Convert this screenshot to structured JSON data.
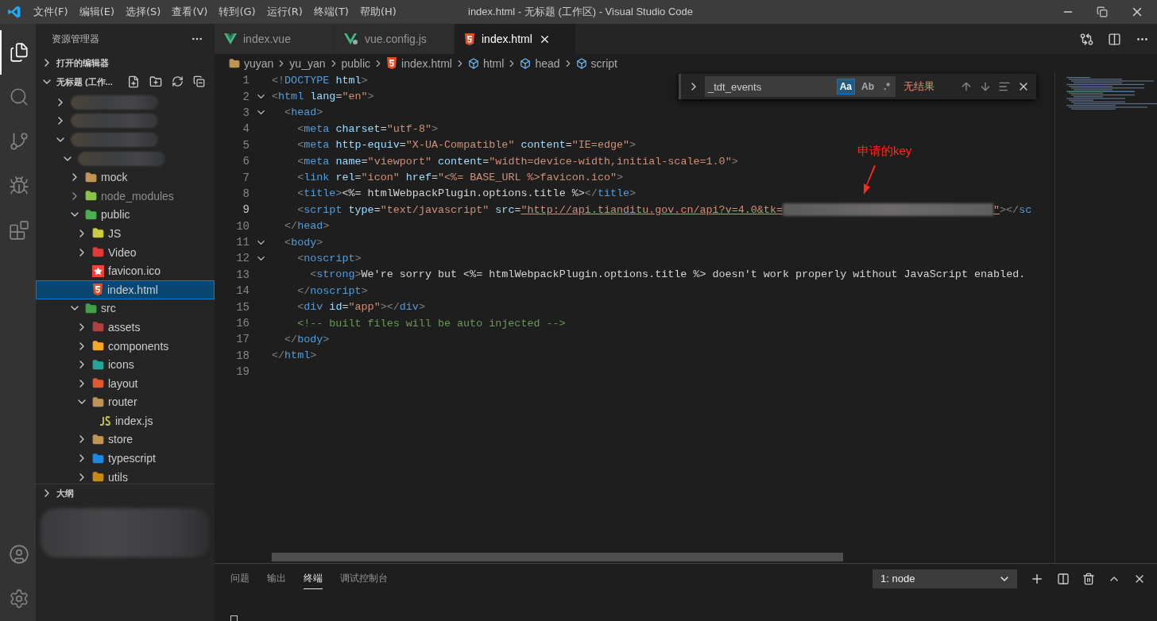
{
  "window": {
    "title": "index.html - 无标题 (工作区) - Visual Studio Code"
  },
  "menu": [
    "文件(F)",
    "编辑(E)",
    "选择(S)",
    "查看(V)",
    "转到(G)",
    "运行(R)",
    "终端(T)",
    "帮助(H)"
  ],
  "activity_bar": [
    {
      "kind": "explorer",
      "selected": true
    },
    {
      "kind": "search",
      "selected": false
    },
    {
      "kind": "scm",
      "selected": false
    },
    {
      "kind": "debug",
      "selected": false
    },
    {
      "kind": "extensions",
      "selected": false
    }
  ],
  "sidebar": {
    "title": "资源管理器",
    "open_editors": {
      "label": "打开的编辑器",
      "expanded": false
    },
    "workspace": {
      "label": "无标题 (工作...",
      "expanded": true
    },
    "tree": [
      {
        "kind": "blurred",
        "expanded": false,
        "selected": false,
        "dimmed": false
      },
      {
        "kind": "blurred",
        "expanded": false,
        "selected": false,
        "dimmed": false
      },
      {
        "kind": "blurred",
        "expanded": true,
        "selected": false,
        "dimmed": false,
        "children": [
          {
            "kind": "blurred",
            "expanded": true,
            "selected": false,
            "dimmed": false,
            "children": [
              {
                "kind": "folder",
                "label": "mock",
                "color": "#c09553",
                "expanded": false,
                "selected": false,
                "dimmed": false
              },
              {
                "kind": "folder",
                "label": "node_modules",
                "color": "#8bc34a",
                "expanded": false,
                "selected": false,
                "dimmed": true
              },
              {
                "kind": "folder",
                "label": "public",
                "color": "#4caf50",
                "expanded": true,
                "selected": false,
                "dimmed": false,
                "children": [
                  {
                    "kind": "folder",
                    "label": "JS",
                    "color": "#cbcb41",
                    "expanded": false,
                    "selected": false,
                    "dimmed": false
                  },
                  {
                    "kind": "folder",
                    "label": "Video",
                    "color": "#e53935",
                    "expanded": false,
                    "selected": false,
                    "dimmed": false
                  },
                  {
                    "kind": "image",
                    "label": "favicon.ico",
                    "selected": false,
                    "dimmed": false
                  },
                  {
                    "kind": "html",
                    "label": "index.html",
                    "selected": true,
                    "dimmed": false
                  }
                ]
              },
              {
                "kind": "folder",
                "label": "src",
                "color": "#43a047",
                "expanded": true,
                "selected": false,
                "dimmed": false,
                "children": [
                  {
                    "kind": "folder",
                    "label": "assets",
                    "color": "#b0413e",
                    "expanded": false,
                    "selected": false,
                    "dimmed": false
                  },
                  {
                    "kind": "folder",
                    "label": "components",
                    "color": "#f9a825",
                    "expanded": false,
                    "selected": false,
                    "dimmed": false
                  },
                  {
                    "kind": "folder",
                    "label": "icons",
                    "color": "#26a69a",
                    "expanded": false,
                    "selected": false,
                    "dimmed": false
                  },
                  {
                    "kind": "folder",
                    "label": "layout",
                    "color": "#e4572e",
                    "expanded": false,
                    "selected": false,
                    "dimmed": false
                  },
                  {
                    "kind": "folder",
                    "label": "router",
                    "color": "#c09553",
                    "expanded": true,
                    "selected": false,
                    "dimmed": false,
                    "children": [
                      {
                        "kind": "script",
                        "label": "index.js",
                        "selected": false,
                        "dimmed": false
                      }
                    ]
                  },
                  {
                    "kind": "folder",
                    "label": "store",
                    "color": "#c09553",
                    "expanded": false,
                    "selected": false,
                    "dimmed": false
                  },
                  {
                    "kind": "folder",
                    "label": "typescript",
                    "color": "#1e88e5",
                    "expanded": false,
                    "selected": false,
                    "dimmed": false
                  },
                  {
                    "kind": "folder",
                    "label": "utils",
                    "color": "#c98b0f",
                    "expanded": false,
                    "selected": false,
                    "dimmed": false
                  }
                ]
              }
            ]
          }
        ]
      }
    ],
    "outline": {
      "label": "大纲",
      "expanded": false
    }
  },
  "editor_tabs": [
    {
      "label": "index.vue",
      "kind": "vue",
      "selected": false
    },
    {
      "label": "vue.config.js",
      "kind": "vueconfig",
      "selected": false
    },
    {
      "label": "index.html",
      "kind": "html",
      "selected": true
    }
  ],
  "breadcrumbs": [
    {
      "label": "yuyan",
      "kind": "folder"
    },
    {
      "label": "yu_yan",
      "kind": "plain"
    },
    {
      "label": "public",
      "kind": "plain"
    },
    {
      "label": "index.html",
      "kind": "html"
    },
    {
      "label": "html",
      "kind": "symbol"
    },
    {
      "label": "head",
      "kind": "symbol"
    },
    {
      "label": "script",
      "kind": "symbol"
    }
  ],
  "find_widget": {
    "value": "_tdt_events",
    "options": [
      {
        "label": "Aa",
        "selected": true
      },
      {
        "label": "Ab",
        "selected": false
      },
      {
        "label": ".*",
        "selected": false
      }
    ],
    "status": "无结果",
    "expanded": false
  },
  "code_lines": [
    {
      "number": "1",
      "foldable": false,
      "current": false,
      "text": "<!DOCTYPE html>"
    },
    {
      "number": "2",
      "foldable": true,
      "current": false,
      "text": "<html lang=\"en\">"
    },
    {
      "number": "3",
      "foldable": true,
      "current": false,
      "text": "  <head>"
    },
    {
      "number": "4",
      "foldable": false,
      "current": false,
      "text": "    <meta charset=\"utf-8\">"
    },
    {
      "number": "5",
      "foldable": false,
      "current": false,
      "text": "    <meta http-equiv=\"X-UA-Compatible\" content=\"IE=edge\">"
    },
    {
      "number": "6",
      "foldable": false,
      "current": false,
      "text": "    <meta name=\"viewport\" content=\"width=device-width,initial-scale=1.0\">"
    },
    {
      "number": "7",
      "foldable": false,
      "current": false,
      "text": "    <link rel=\"icon\" href=\"<%= BASE_URL %>favicon.ico\">"
    },
    {
      "number": "8",
      "foldable": false,
      "current": false,
      "text": "    <title><%= htmlWebpackPlugin.options.title %></title>"
    },
    {
      "number": "9",
      "foldable": false,
      "current": true,
      "text": "    <script type=\"text/javascript\" src=\"http://api.tianditu.gov.cn/api?v=4.0&tk=",
      "redacted": true,
      "text_after": "\"></sc"
    },
    {
      "number": "10",
      "foldable": false,
      "current": false,
      "text": "  </head>"
    },
    {
      "number": "11",
      "foldable": true,
      "current": false,
      "text": "  <body>"
    },
    {
      "number": "12",
      "foldable": true,
      "current": false,
      "text": "    <noscript>"
    },
    {
      "number": "13",
      "foldable": false,
      "current": false,
      "text": "      <strong>We're sorry but <%= htmlWebpackPlugin.options.title %> doesn't work properly without JavaScript enabled."
    },
    {
      "number": "14",
      "foldable": false,
      "current": false,
      "text": "    </noscript>"
    },
    {
      "number": "15",
      "foldable": false,
      "current": false,
      "text": "    <div id=\"app\"></div>"
    },
    {
      "number": "16",
      "foldable": false,
      "current": false,
      "text": "    <!-- built files will be auto injected -->"
    },
    {
      "number": "17",
      "foldable": false,
      "current": false,
      "text": "  </body>"
    },
    {
      "number": "18",
      "foldable": false,
      "current": false,
      "text": "</html>"
    },
    {
      "number": "19",
      "foldable": false,
      "current": false
    }
  ],
  "annotation": {
    "text": "申请的key"
  },
  "panel": {
    "tabs": [
      {
        "label": "问题",
        "selected": false
      },
      {
        "label": "输出",
        "selected": false
      },
      {
        "label": "终端",
        "selected": true
      },
      {
        "label": "调试控制台",
        "selected": false
      }
    ],
    "terminal_select": "1: node"
  }
}
